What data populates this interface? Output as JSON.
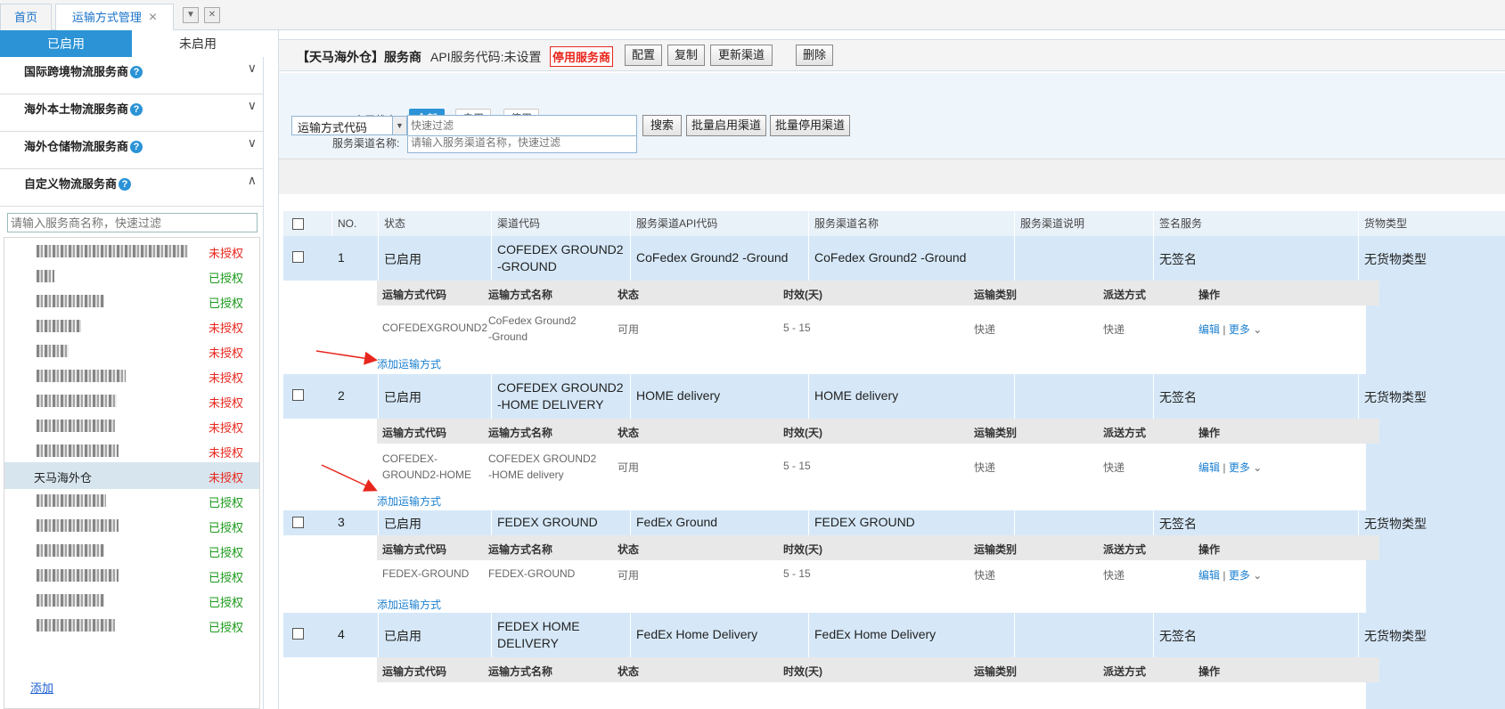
{
  "top_tabs": {
    "home": "首页",
    "active": "运输方式管理",
    "close": "×"
  },
  "sidebar": {
    "tab_enabled": "已启用",
    "tab_disabled": "未启用",
    "groups": [
      {
        "label": "国际跨境物流服务商",
        "help": "?",
        "chevron": "∨"
      },
      {
        "label": "海外本土物流服务商",
        "help": "?",
        "chevron": "∨"
      },
      {
        "label": "海外仓储物流服务商",
        "help": "?",
        "chevron": "∨"
      },
      {
        "label": "自定义物流服务商",
        "help": "?",
        "chevron": "∧"
      }
    ],
    "filter_placeholder": "请输入服务商名称，快速过滤",
    "providers": [
      {
        "name": "",
        "status": "未授权"
      },
      {
        "name": "",
        "status": "已授权"
      },
      {
        "name": "",
        "status": "已授权"
      },
      {
        "name": "",
        "status": "未授权"
      },
      {
        "name": "",
        "status": "未授权"
      },
      {
        "name": "",
        "status": "未授权"
      },
      {
        "name": "",
        "status": "未授权"
      },
      {
        "name": "",
        "status": "未授权"
      },
      {
        "name": "",
        "status": "未授权"
      },
      {
        "name": "天马海外仓",
        "status": "未授权"
      },
      {
        "name": "",
        "status": "已授权"
      },
      {
        "name": "",
        "status": "已授权"
      },
      {
        "name": "",
        "status": "已授权"
      },
      {
        "name": "",
        "status": "已授权"
      },
      {
        "name": "",
        "status": "已授权"
      },
      {
        "name": "",
        "status": "已授权"
      }
    ],
    "add_link": "添加"
  },
  "header": {
    "title": "【天马海外仓】服务商",
    "api_code": "API服务代码:未设置",
    "stop_label": "停用服务商",
    "buttons": [
      "配置",
      "复制",
      "更新渠道",
      "删除"
    ]
  },
  "filters": {
    "status_label": "启用状态:",
    "status_options": [
      "全部",
      "启用",
      "停用"
    ],
    "name_label": "服务渠道名称:",
    "name_placeholder": "请输入服务渠道名称，快速过滤",
    "select_value": "运输方式代码",
    "quick_placeholder": "快速过滤",
    "search_btn": "搜索",
    "batch_enable": "批量启用渠道",
    "batch_disable": "批量停用渠道"
  },
  "table": {
    "headers": [
      "NO.",
      "状态",
      "渠道代码",
      "服务渠道API代码",
      "服务渠道名称",
      "服务渠道说明",
      "签名服务",
      "货物类型"
    ],
    "sub_headers": [
      "运输方式代码",
      "运输方式名称",
      "状态",
      "时效(天)",
      "运输类别",
      "派送方式",
      "操作"
    ],
    "add_method": "添加运输方式",
    "edit": "编辑",
    "sep": "|",
    "more": "更多",
    "rows": [
      {
        "no": "1",
        "status": "已启用",
        "code_l1": "COFEDEX GROUND2",
        "code_l2": "-GROUND",
        "api": "CoFedex Ground2 -Ground",
        "name": "CoFedex Ground2 -Ground",
        "desc": "",
        "sign": "无签名",
        "cargo": "无货物类型",
        "sub": {
          "code_l1": "COFEDEXGROUND2",
          "code_l2": "",
          "name_l1": "CoFedex Ground2",
          "name_l2": "-Ground",
          "state": "可用",
          "days": "5 - 15",
          "type": "快递",
          "delivery": "快递"
        }
      },
      {
        "no": "2",
        "status": "已启用",
        "code_l1": "COFEDEX GROUND2",
        "code_l2": "-HOME DELIVERY",
        "api": "HOME delivery",
        "name": "HOME delivery",
        "desc": "",
        "sign": "无签名",
        "cargo": "无货物类型",
        "sub": {
          "code_l1": "COFEDEX-",
          "code_l2": "GROUND2-HOME",
          "name_l1": "COFEDEX GROUND2",
          "name_l2": "-HOME delivery",
          "state": "可用",
          "days": "5 - 15",
          "type": "快递",
          "delivery": "快递"
        }
      },
      {
        "no": "3",
        "status": "已启用",
        "code_l1": "FEDEX GROUND",
        "code_l2": "",
        "api": "FedEx Ground",
        "name": "FEDEX GROUND",
        "desc": "",
        "sign": "无签名",
        "cargo": "无货物类型",
        "sub": {
          "code_l1": "FEDEX-GROUND",
          "code_l2": "",
          "name_l1": "FEDEX-GROUND",
          "name_l2": "",
          "state": "可用",
          "days": "5 - 15",
          "type": "快递",
          "delivery": "快递"
        }
      },
      {
        "no": "4",
        "status": "已启用",
        "code_l1": "FEDEX HOME",
        "code_l2": "DELIVERY",
        "api": "FedEx Home Delivery",
        "name": "FedEx Home Delivery",
        "desc": "",
        "sign": "无签名",
        "cargo": "无货物类型"
      }
    ]
  },
  "colors": {
    "accent": "#2b93d6",
    "row_blue": "#d6e8f8",
    "red": "#e8261d",
    "green": "#1a9a1a"
  }
}
